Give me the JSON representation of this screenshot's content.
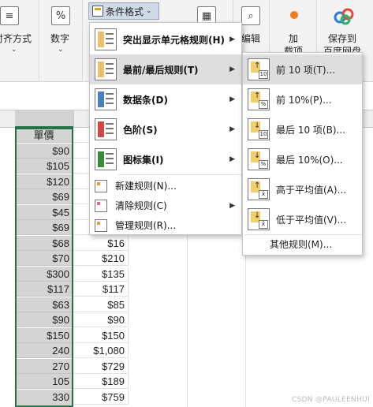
{
  "ribbon": {
    "align_label": "对齐方式",
    "number_label": "数字",
    "cf_button": "条件格式",
    "edit_label": "编辑",
    "add_label": "加",
    "add_label2": "载项",
    "save_label": "保存到",
    "save_label2": "百度网盘"
  },
  "sheet": {
    "header_cell": "單價",
    "colA": [
      "$90",
      "$105",
      "$120",
      "$69",
      "$45",
      "$69",
      "$68",
      "$70",
      "$300",
      "$117",
      "$63",
      "$90",
      "$150",
      "240",
      "270",
      "105",
      "330"
    ],
    "colB": [
      "",
      "",
      "",
      "",
      "",
      "",
      "$16",
      "$210",
      "$135",
      "$117",
      "$85",
      "$90",
      "$150",
      "$1,080",
      "$729",
      "$189",
      "$759"
    ]
  },
  "menu": {
    "items": [
      {
        "label": "突出显示单元格规则(H)",
        "icon": "highlight-cells-icon"
      },
      {
        "label": "最前/最后规则(T)",
        "icon": "top-bottom-icon"
      },
      {
        "label": "数据条(D)",
        "icon": "data-bars-icon"
      },
      {
        "label": "色阶(S)",
        "icon": "color-scales-icon"
      },
      {
        "label": "图标集(I)",
        "icon": "icon-sets-icon"
      }
    ],
    "small_items": [
      {
        "label": "新建规则(N)...",
        "icon": "new-rule-icon"
      },
      {
        "label": "清除规则(C)",
        "icon": "clear-rules-icon"
      },
      {
        "label": "管理规则(R)...",
        "icon": "manage-rules-icon"
      }
    ]
  },
  "submenu": {
    "items": [
      {
        "label": "前 10 项(T)...",
        "badge": "10"
      },
      {
        "label": "前 10%(P)...",
        "badge": "%"
      },
      {
        "label": "最后 10 项(B)...",
        "badge": "10"
      },
      {
        "label": "最后 10%(O)...",
        "badge": "%"
      },
      {
        "label": "高于平均值(A)...",
        "badge": "x̄"
      },
      {
        "label": "低于平均值(V)...",
        "badge": "x̄"
      }
    ],
    "more": "其他规则(M)..."
  },
  "watermark": "CSDN @PAULEENHUI"
}
